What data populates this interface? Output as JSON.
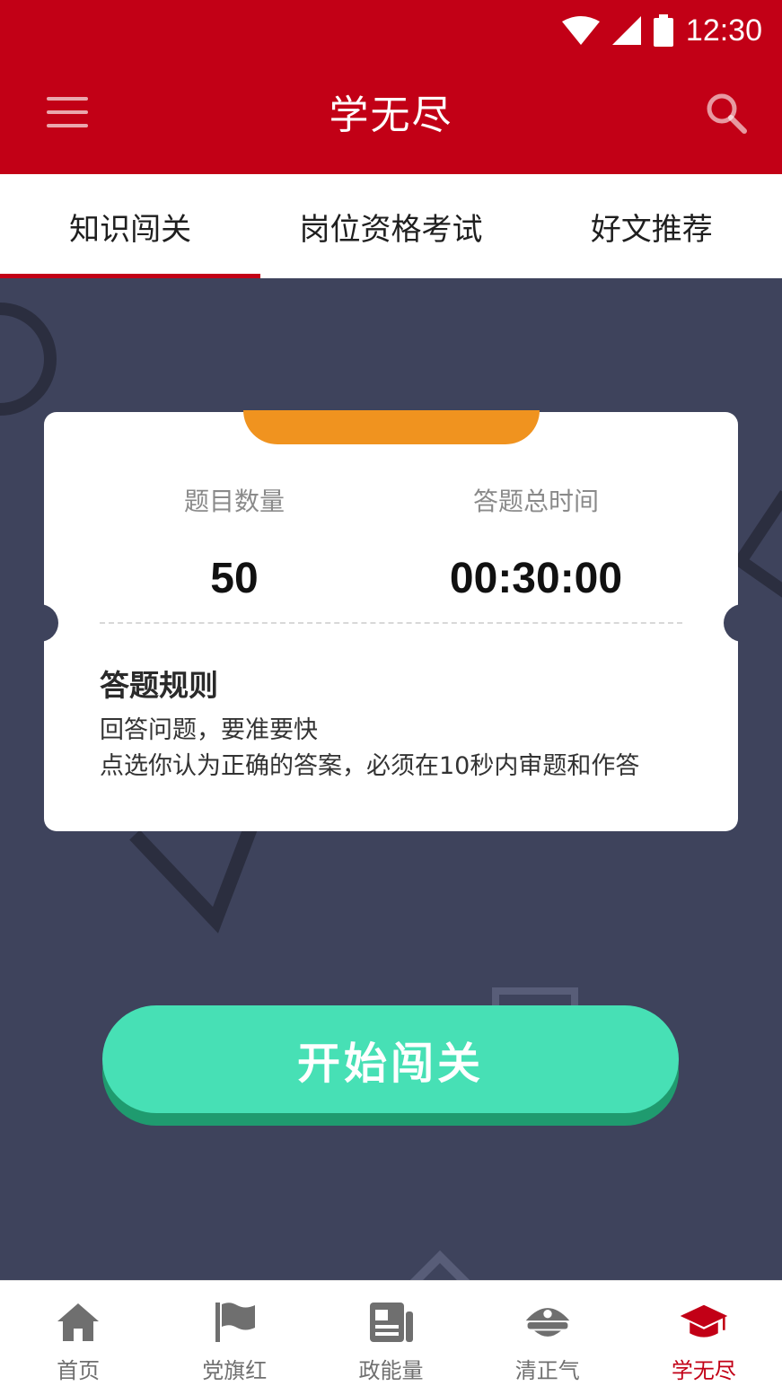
{
  "status_bar": {
    "time": "12:30"
  },
  "header": {
    "title": "学无尽"
  },
  "tabs": [
    {
      "label": "知识闯关",
      "active": true
    },
    {
      "label": "岗位资格考试",
      "active": false
    },
    {
      "label": "好文推荐",
      "active": false
    }
  ],
  "card": {
    "question_count_label": "题目数量",
    "question_count": "50",
    "total_time_label": "答题总时间",
    "total_time": "00:30:00",
    "rules_title": "答题规则",
    "rules": [
      "回答问题，要准要快",
      "点选你认为正确的答案，必须在10秒内审题和作答"
    ]
  },
  "start_button": {
    "label": "开始闯关"
  },
  "bottom_nav": [
    {
      "label": "首页",
      "icon": "home-icon",
      "active": false
    },
    {
      "label": "党旗红",
      "icon": "flag-icon",
      "active": false
    },
    {
      "label": "政能量",
      "icon": "newspaper-icon",
      "active": false
    },
    {
      "label": "清正气",
      "icon": "police-cap-icon",
      "active": false
    },
    {
      "label": "学无尽",
      "icon": "graduation-cap-icon",
      "active": true
    }
  ],
  "colors": {
    "brand_red": "#c20016",
    "background_navy": "#3e435c",
    "accent_orange": "#f0931f",
    "button_green": "#47e0b5",
    "nav_inactive": "#6f6f6f"
  }
}
